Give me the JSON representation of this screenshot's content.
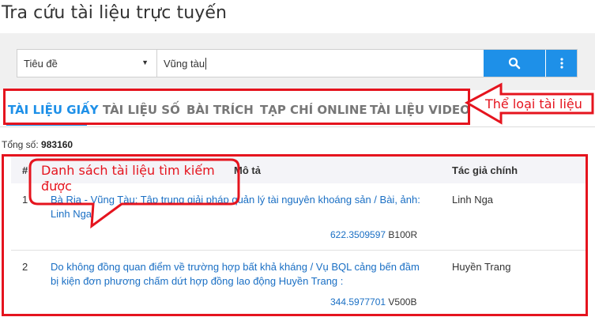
{
  "page": {
    "title": "Tra cứu tài liệu trực tuyến"
  },
  "search": {
    "field_label": "Tiêu đề",
    "query": "Vũng tàu",
    "search_icon": "magnifier-icon",
    "more_icon": "vertical-dots-icon"
  },
  "tabs": [
    {
      "label": "TÀI LIỆU GIẤY",
      "active": true
    },
    {
      "label": "TÀI LIỆU SỐ",
      "active": false
    },
    {
      "label": "BÀI TRÍCH",
      "active": false
    },
    {
      "label": "TẠP CHÍ ONLINE",
      "active": false
    },
    {
      "label": "TÀI LIỆU VIDEO",
      "active": false
    }
  ],
  "results": {
    "total_label": "Tổng số:",
    "total_value": "983160",
    "columns": {
      "num": "#",
      "desc": "Mô tả",
      "author": "Tác giả chính"
    },
    "rows": [
      {
        "num": "1",
        "desc_line1": "Bà Rịa - Vũng Tàu: Tập trung giải pháp quản lý tài nguyên khoáng sản / Bài, ảnh:",
        "desc_line2": "Linh Nga",
        "author": "Linh Nga",
        "call_number": "622.3509597",
        "call_code": "B100R"
      },
      {
        "num": "2",
        "desc_line1": "Do không đồng quan điểm về trường hợp bất khả kháng / Vụ BQL cảng bến đầm",
        "desc_line2": "bị kiện đơn phương chấm dứt hợp đồng lao động Huyền Trang :",
        "author": "Huyền Trang",
        "call_number": "344.5977701",
        "call_code": "V500B"
      }
    ]
  },
  "annotations": {
    "tabs_label": "Thể loại tài liệu",
    "list_label_line1": "Danh sách tài liệu tìm kiếm",
    "list_label_line2": "được",
    "color": "#e5141e"
  },
  "colors": {
    "accent": "#1e90e8",
    "link": "#1a6fc4"
  }
}
